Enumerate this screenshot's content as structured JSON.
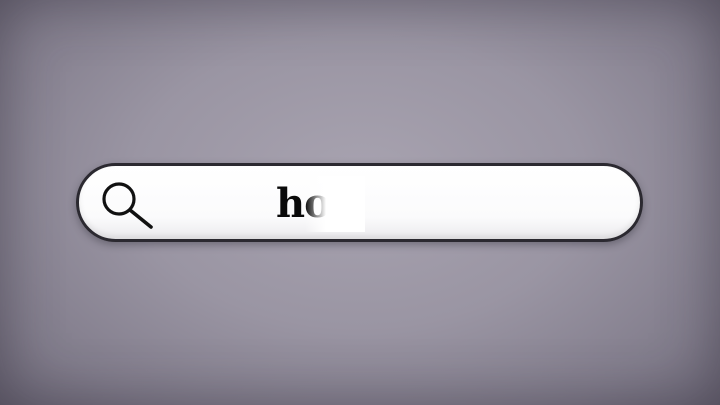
{
  "search": {
    "value": "ho",
    "icon": "search-icon"
  },
  "colors": {
    "background": "#9a95a3",
    "field": "#ffffff",
    "border": "#2b2930",
    "text": "#0a0a0a"
  }
}
